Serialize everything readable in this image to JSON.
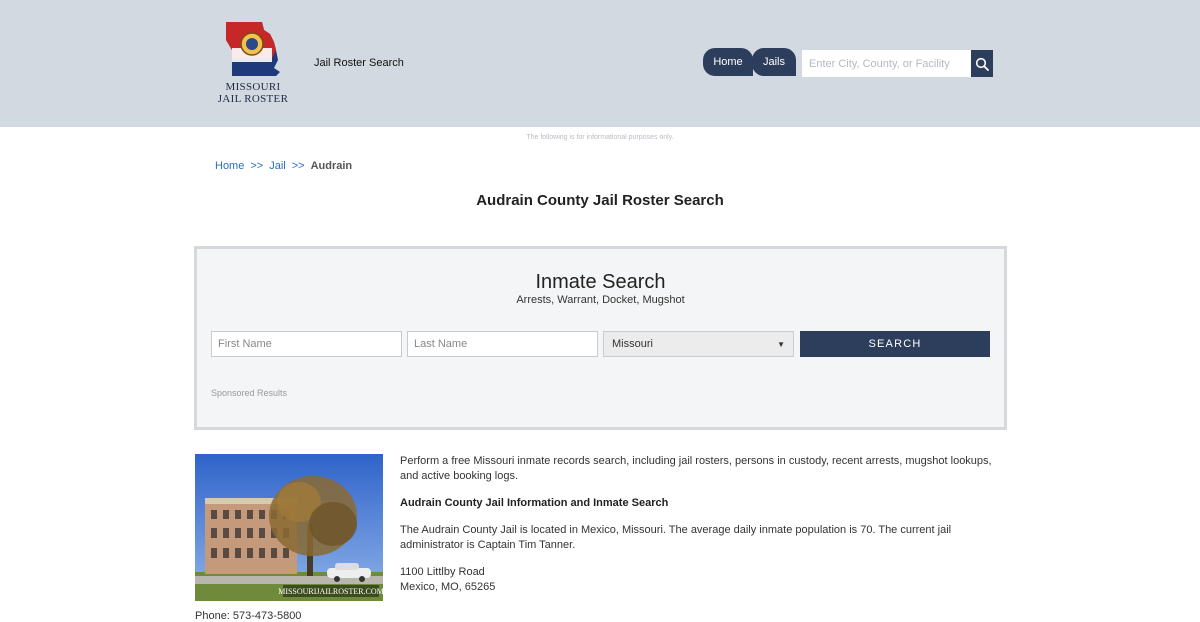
{
  "header": {
    "logo_text_line1": "MISSOURI",
    "logo_text_line2": "JAIL ROSTER",
    "site_title": "Jail Roster Search",
    "nav": [
      {
        "label": "Home"
      },
      {
        "label": "Jails"
      }
    ],
    "search_placeholder": "Enter City, County, or Facility"
  },
  "disclaimer": "The following is for informational purposes only.",
  "breadcrumb": {
    "items": [
      "Home",
      "Jail"
    ],
    "separator": ">>",
    "current": "Audrain"
  },
  "page_title": "Audrain County Jail Roster Search",
  "inmate_search": {
    "title": "Inmate Search",
    "subtitle": "Arrests, Warrant, Docket, Mugshot",
    "first_name_placeholder": "First Name",
    "last_name_placeholder": "Last Name",
    "state_selected": "Missouri",
    "search_button": "SEARCH",
    "sponsored": "Sponsored Results"
  },
  "content": {
    "photo_watermark": "MISSOURIJAILROSTER.COM",
    "intro": "Perform a free Missouri inmate records search, including jail rosters, persons in custody, recent arrests, mugshot lookups, and active booking logs.",
    "section_heading": "Audrain County Jail Information and Inmate Search",
    "details": "The Audrain County Jail is located in Mexico, Missouri. The average daily inmate population is 70. The current jail administrator is Captain Tim Tanner.",
    "address_line1": "1100 Littlby Road",
    "address_line2": "Mexico, MO, 65265",
    "phone": "Phone: 573-473-5800"
  },
  "colors": {
    "header_bg": "#d3d9e1",
    "accent": "#2c3e5c",
    "link": "#2b6cc4"
  },
  "icons": {
    "search": "magnifier-icon",
    "logo": "missouri-state-seal-icon",
    "select_arrow": "chevron-down-icon"
  }
}
